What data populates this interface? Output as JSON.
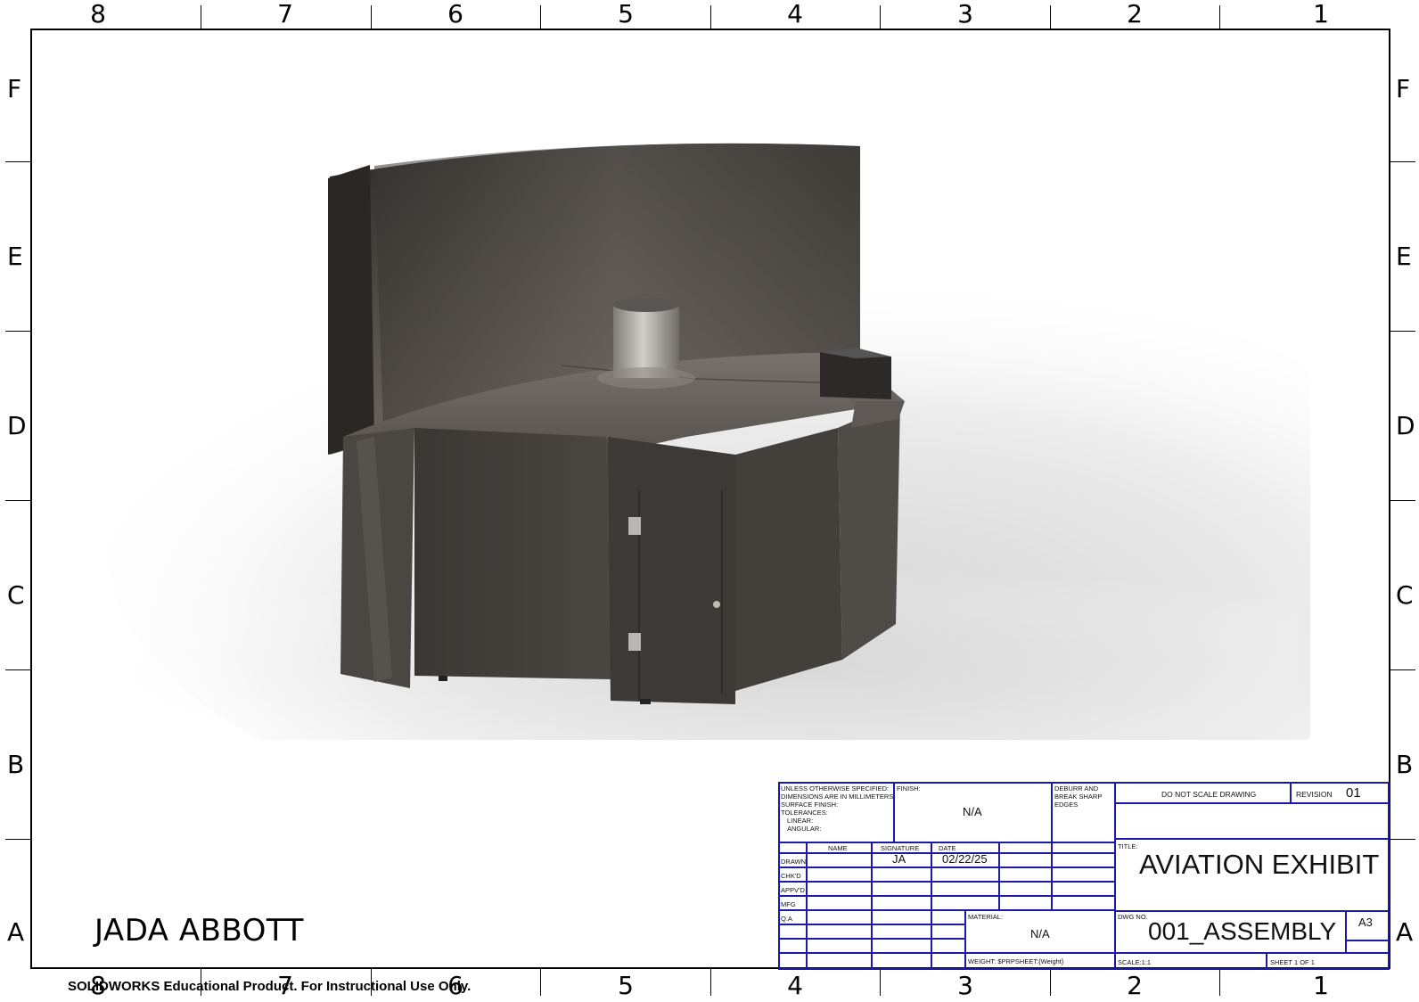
{
  "border": {
    "zone_columns": [
      "8",
      "7",
      "6",
      "5",
      "4",
      "3",
      "2",
      "1"
    ],
    "zone_rows": [
      "F",
      "E",
      "D",
      "C",
      "B",
      "A"
    ]
  },
  "drafter_name": "JADA ABBOTT",
  "edu_notice": "SOLIDWORKS Educational Product. For Instructional Use Only.",
  "title_block": {
    "spec_note": [
      "UNLESS OTHERWISE SPECIFIED:",
      "DIMENSIONS ARE IN MILLIMETERS",
      "SURFACE FINISH:",
      "TOLERANCES:",
      "LINEAR:",
      "ANGULAR:"
    ],
    "finish_label": "FINISH:",
    "finish_value": "N/A",
    "deburr_note": [
      "DEBURR AND",
      "BREAK SHARP",
      "EDGES"
    ],
    "do_not_scale": "DO NOT SCALE DRAWING",
    "revision_label": "REVISION",
    "revision_value": "01",
    "col_name": "NAME",
    "col_signature": "SIGNATURE",
    "col_date": "DATE",
    "rows": [
      "DRAWN",
      "CHK'D",
      "APPV'D",
      "MFG",
      "Q.A"
    ],
    "drawn_signature": "JA",
    "drawn_date": "02/22/25",
    "title_label": "TITLE:",
    "title_value": "AVIATION EXHIBIT",
    "material_label": "MATERIAL:",
    "material_value": "N/A",
    "dwg_no_label": "DWG NO.",
    "dwg_no_value": "001_ASSEMBLY",
    "sheet_size": "A3",
    "weight_label": "WEIGHT: $PRPSHEET:{Weight}",
    "scale_label": "SCALE:1:1",
    "sheet_label": "SHEET 1 OF 1"
  },
  "colors": {
    "title_block_lines": "#1a1aa6",
    "model_dark": "#3f3b38"
  }
}
